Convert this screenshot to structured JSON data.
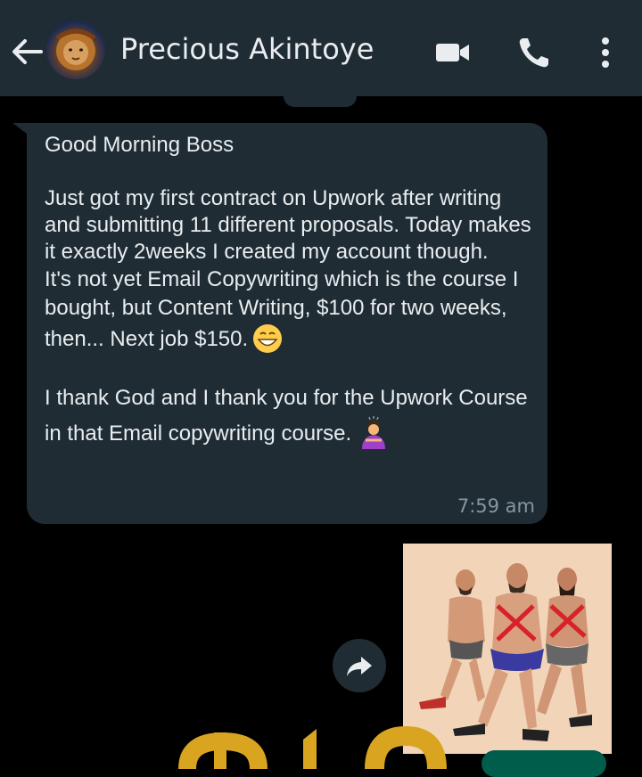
{
  "header": {
    "contact_name": "Precious Akintoye",
    "icons": [
      "back-arrow-icon",
      "contact-avatar",
      "video-call-icon",
      "voice-call-icon",
      "more-options-icon"
    ]
  },
  "message": {
    "greeting": "Good Morning Boss",
    "paragraph1": "Just got my first contract on Upwork after writing and submitting 11 different proposals. Today makes it exactly 2weeks I created my account though.",
    "paragraph2_line": "It's not yet Email Copywriting which is the course I bought, but Content Writing, $100 for two weeks, then... Next job $150.",
    "paragraph3": "I thank God and I thank you for the Upwork Course in that Email copywriting course.",
    "emoji_after_p2": "grinning-face-emoji",
    "emoji_after_p3": "person-bowing-emoji",
    "time": "7:59 am"
  },
  "media": {
    "forward_icon": "forward-arrow-icon",
    "image_icon": "photo-thumbnail"
  },
  "colors": {
    "header_bg": "#1f2c34",
    "bubble_bg": "#1f2c34",
    "text": "#e9edef",
    "meta_text": "#8696a0",
    "outgoing_bg": "#005c4b",
    "gold": "#d9a520"
  }
}
